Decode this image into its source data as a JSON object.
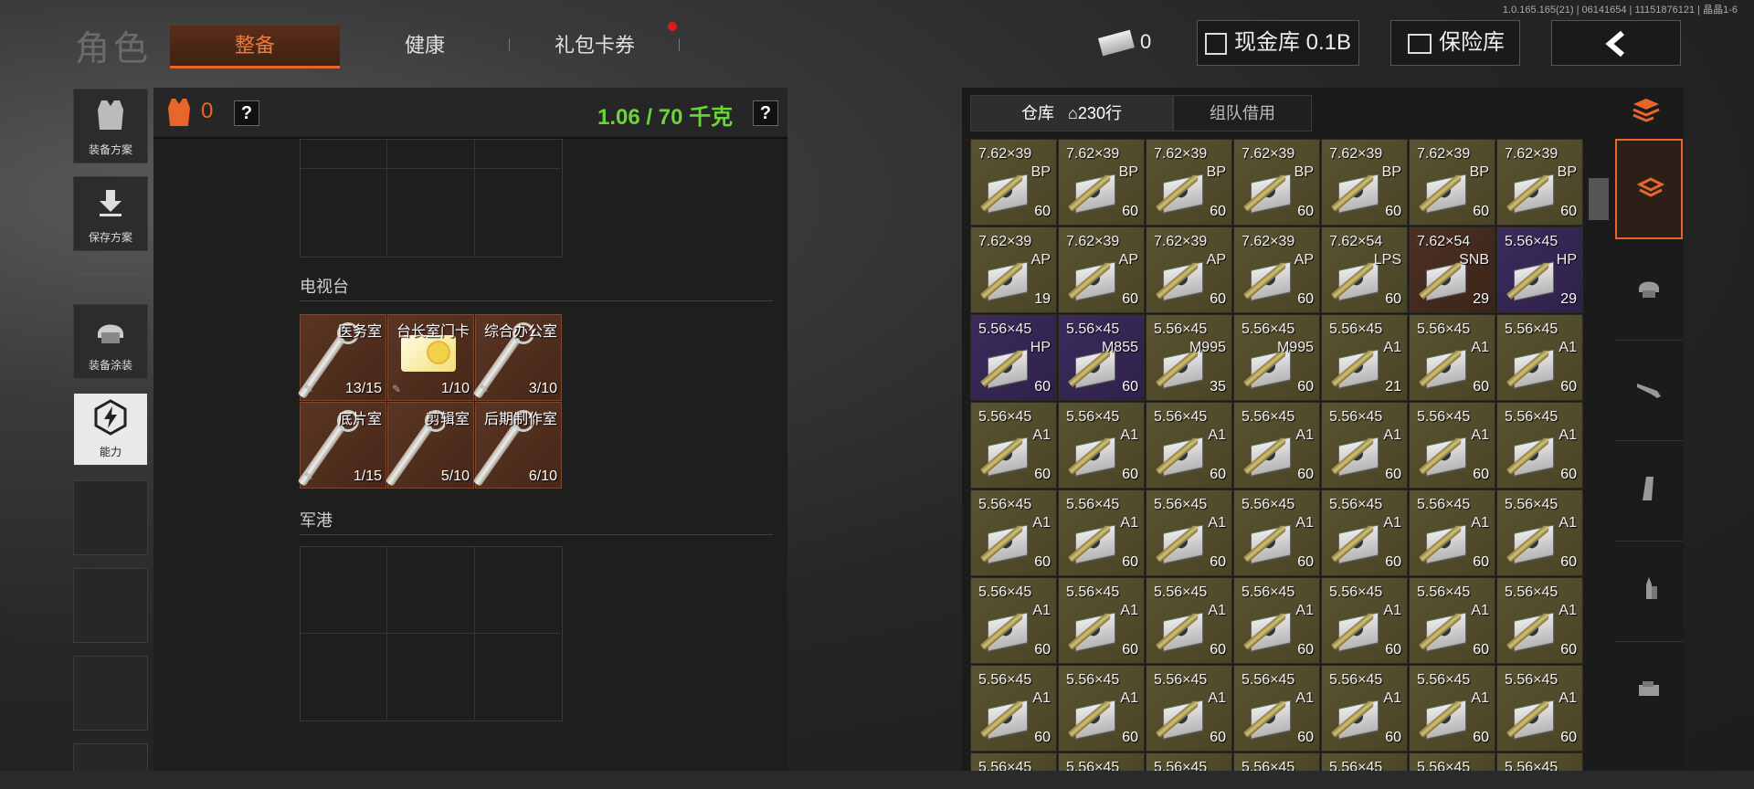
{
  "version": "1.0.165.165(21) | 06141654 | 11151876121 | 晶晶1-6",
  "title": "角色",
  "tabs": [
    {
      "label": "整备",
      "active": true
    },
    {
      "label": "健康",
      "active": false
    },
    {
      "label": "礼包卡券",
      "active": false,
      "badge": true
    }
  ],
  "currency": {
    "cash_count": "0",
    "cash_vault_label": "现金库 0.1B",
    "safe_label": "保险库",
    "back_icon": "chevron-left"
  },
  "left_nav": [
    {
      "label": "装备方案",
      "icon": "vest-icon"
    },
    {
      "label": "保存方案",
      "icon": "download-icon"
    },
    {
      "label": "装备涂装",
      "icon": "helmet-icon"
    },
    {
      "label": "能力",
      "icon": "ability-icon",
      "active": true
    }
  ],
  "panel": {
    "armor_count": "0",
    "weight": "1.06 / 70 千克",
    "help": "?",
    "sections": [
      {
        "name": "电视台"
      },
      {
        "name": "军港"
      }
    ],
    "keys": [
      {
        "name": "医务室",
        "count": "13/15",
        "type": "key"
      },
      {
        "name": "台长室门卡",
        "count": "1/10",
        "type": "card"
      },
      {
        "name": "综合办公室",
        "count": "3/10",
        "type": "key"
      },
      {
        "name": "底片室",
        "count": "1/15",
        "type": "key"
      },
      {
        "name": "剪辑室",
        "count": "5/10",
        "type": "key"
      },
      {
        "name": "后期制作室",
        "count": "6/10",
        "type": "key"
      }
    ]
  },
  "stash": {
    "tab_warehouse": "仓库",
    "tab_rows": "230行",
    "tab_team": "组队借用",
    "items": [
      {
        "cal": "7.62×39",
        "sub": "BP",
        "cnt": "60",
        "c": "bp"
      },
      {
        "cal": "7.62×39",
        "sub": "BP",
        "cnt": "60",
        "c": "bp"
      },
      {
        "cal": "7.62×39",
        "sub": "BP",
        "cnt": "60",
        "c": "bp"
      },
      {
        "cal": "7.62×39",
        "sub": "BP",
        "cnt": "60",
        "c": "bp"
      },
      {
        "cal": "7.62×39",
        "sub": "BP",
        "cnt": "60",
        "c": "bp"
      },
      {
        "cal": "7.62×39",
        "sub": "BP",
        "cnt": "60",
        "c": "bp"
      },
      {
        "cal": "7.62×39",
        "sub": "BP",
        "cnt": "60",
        "c": "bp"
      },
      {
        "cal": "7.62×39",
        "sub": "AP",
        "cnt": "19",
        "c": "bp"
      },
      {
        "cal": "7.62×39",
        "sub": "AP",
        "cnt": "60",
        "c": "bp"
      },
      {
        "cal": "7.62×39",
        "sub": "AP",
        "cnt": "60",
        "c": "bp"
      },
      {
        "cal": "7.62×39",
        "sub": "AP",
        "cnt": "60",
        "c": "bp"
      },
      {
        "cal": "7.62×54",
        "sub": "LPS",
        "cnt": "60",
        "c": "bp"
      },
      {
        "cal": "7.62×54",
        "sub": "SNB",
        "cnt": "29",
        "c": "rd"
      },
      {
        "cal": "5.56×45",
        "sub": "HP",
        "cnt": "29",
        "c": "hp"
      },
      {
        "cal": "5.56×45",
        "sub": "HP",
        "cnt": "60",
        "c": "hp"
      },
      {
        "cal": "5.56×45",
        "sub": "M855",
        "cnt": "60",
        "c": "hp"
      },
      {
        "cal": "5.56×45",
        "sub": "M995",
        "cnt": "35",
        "c": "a1"
      },
      {
        "cal": "5.56×45",
        "sub": "M995",
        "cnt": "60",
        "c": "a1"
      },
      {
        "cal": "5.56×45",
        "sub": "A1",
        "cnt": "21",
        "c": "a1"
      },
      {
        "cal": "5.56×45",
        "sub": "A1",
        "cnt": "60",
        "c": "a1"
      },
      {
        "cal": "5.56×45",
        "sub": "A1",
        "cnt": "60",
        "c": "a1"
      },
      {
        "cal": "5.56×45",
        "sub": "A1",
        "cnt": "60",
        "c": "a1"
      },
      {
        "cal": "5.56×45",
        "sub": "A1",
        "cnt": "60",
        "c": "a1"
      },
      {
        "cal": "5.56×45",
        "sub": "A1",
        "cnt": "60",
        "c": "a1"
      },
      {
        "cal": "5.56×45",
        "sub": "A1",
        "cnt": "60",
        "c": "a1"
      },
      {
        "cal": "5.56×45",
        "sub": "A1",
        "cnt": "60",
        "c": "a1"
      },
      {
        "cal": "5.56×45",
        "sub": "A1",
        "cnt": "60",
        "c": "a1"
      },
      {
        "cal": "5.56×45",
        "sub": "A1",
        "cnt": "60",
        "c": "a1"
      },
      {
        "cal": "5.56×45",
        "sub": "A1",
        "cnt": "60",
        "c": "a1"
      },
      {
        "cal": "5.56×45",
        "sub": "A1",
        "cnt": "60",
        "c": "a1"
      },
      {
        "cal": "5.56×45",
        "sub": "A1",
        "cnt": "60",
        "c": "a1"
      },
      {
        "cal": "5.56×45",
        "sub": "A1",
        "cnt": "60",
        "c": "a1"
      },
      {
        "cal": "5.56×45",
        "sub": "A1",
        "cnt": "60",
        "c": "a1"
      },
      {
        "cal": "5.56×45",
        "sub": "A1",
        "cnt": "60",
        "c": "a1"
      },
      {
        "cal": "5.56×45",
        "sub": "A1",
        "cnt": "60",
        "c": "a1"
      },
      {
        "cal": "5.56×45",
        "sub": "A1",
        "cnt": "60",
        "c": "a1"
      },
      {
        "cal": "5.56×45",
        "sub": "A1",
        "cnt": "60",
        "c": "a1"
      },
      {
        "cal": "5.56×45",
        "sub": "A1",
        "cnt": "60",
        "c": "a1"
      },
      {
        "cal": "5.56×45",
        "sub": "A1",
        "cnt": "60",
        "c": "a1"
      },
      {
        "cal": "5.56×45",
        "sub": "A1",
        "cnt": "60",
        "c": "a1"
      },
      {
        "cal": "5.56×45",
        "sub": "A1",
        "cnt": "60",
        "c": "a1"
      },
      {
        "cal": "5.56×45",
        "sub": "A1",
        "cnt": "60",
        "c": "a1"
      },
      {
        "cal": "5.56×45",
        "sub": "A1",
        "cnt": "60",
        "c": "a1"
      },
      {
        "cal": "5.56×45",
        "sub": "A1",
        "cnt": "60",
        "c": "a1"
      },
      {
        "cal": "5.56×45",
        "sub": "A1",
        "cnt": "60",
        "c": "a1"
      },
      {
        "cal": "5.56×45",
        "sub": "A1",
        "cnt": "60",
        "c": "a1"
      },
      {
        "cal": "5.56×45",
        "sub": "A1",
        "cnt": "60",
        "c": "a1"
      },
      {
        "cal": "5.56×45",
        "sub": "A1",
        "cnt": "60",
        "c": "a1"
      },
      {
        "cal": "5.56×45",
        "sub": "A1",
        "cnt": "60",
        "c": "a1"
      },
      {
        "cal": "5.56×45",
        "sub": "",
        "cnt": "",
        "c": "a1"
      },
      {
        "cal": "5.56×45",
        "sub": "",
        "cnt": "",
        "c": "a1"
      },
      {
        "cal": "5.56×45",
        "sub": "",
        "cnt": "",
        "c": "a1"
      },
      {
        "cal": "5.56×45",
        "sub": "",
        "cnt": "",
        "c": "a1"
      },
      {
        "cal": "5.56×45",
        "sub": "",
        "cnt": "",
        "c": "a1"
      },
      {
        "cal": "5.56×45",
        "sub": "",
        "cnt": "",
        "c": "a1"
      },
      {
        "cal": "5.56×45",
        "sub": "",
        "cnt": "",
        "c": "a1"
      }
    ]
  },
  "right_tools": [
    "stack-sort-icon",
    "all-items-icon",
    "armor-icon",
    "rifle-icon",
    "magazine-icon",
    "ammo-icon",
    "sight-icon"
  ],
  "colors": {
    "accent": "#e8652b",
    "weight": "#6ad43a",
    "ammo": "#5a5331",
    "rare": "#3b2c5d"
  }
}
